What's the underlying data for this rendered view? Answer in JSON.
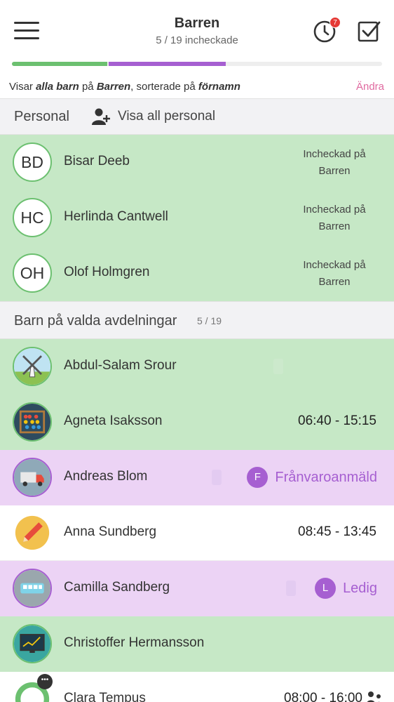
{
  "header": {
    "title": "Barren",
    "subtitle": "5 / 19 incheckade",
    "notification_count": "7"
  },
  "progress": {
    "green_fraction": 0.262,
    "purple_fraction": 0.317
  },
  "filter": {
    "prefix": "Visar ",
    "scope": "alla barn",
    "middle": " på ",
    "location": "Barren",
    "sorted": ", sorterade på ",
    "sort_key": "förnamn",
    "change_label": "Ändra"
  },
  "staff_section": {
    "title": "Personal",
    "show_all_label": "Visa all personal",
    "people": [
      {
        "initials": "BD",
        "name": "Bisar Deeb",
        "status_line1": "Incheckad på",
        "status_line2": "Barren"
      },
      {
        "initials": "HC",
        "name": "Herlinda Cantwell",
        "status_line1": "Incheckad på",
        "status_line2": "Barren"
      },
      {
        "initials": "OH",
        "name": "Olof Holmgren",
        "status_line1": "Incheckad på",
        "status_line2": "Barren"
      }
    ]
  },
  "children_section": {
    "title": "Barn på valda avdelningar",
    "count": "5 / 19",
    "children": [
      {
        "name": "Abdul-Salam Srour",
        "avatar_icon": "windmill-icon",
        "time": ""
      },
      {
        "name": "Agneta Isaksson",
        "avatar_icon": "abacus-icon",
        "time": "06:40 - 15:15"
      },
      {
        "name": "Andreas Blom",
        "avatar_icon": "truck-icon",
        "absence_letter": "F",
        "absence_label": "Frånvaroanmäld"
      },
      {
        "name": "Anna Sundberg",
        "avatar_icon": "pencil-icon",
        "time": "08:45 - 13:45"
      },
      {
        "name": "Camilla Sandberg",
        "avatar_icon": "bus-icon",
        "absence_letter": "L",
        "absence_label": "Ledig"
      },
      {
        "name": "Christoffer Hermansson",
        "avatar_icon": "monitor-chart-icon",
        "time": ""
      },
      {
        "name": "Clara Tempus",
        "avatar_icon": "ring-icon",
        "time": "08:00 - 16:00",
        "chat_badge": "•••"
      }
    ]
  },
  "colors": {
    "checked_in": "#c6e8c6",
    "absent": "#ecd3f5",
    "accent_pink": "#e06aa0",
    "accent_purple": "#a65fd1",
    "accent_green": "#6cc070"
  }
}
